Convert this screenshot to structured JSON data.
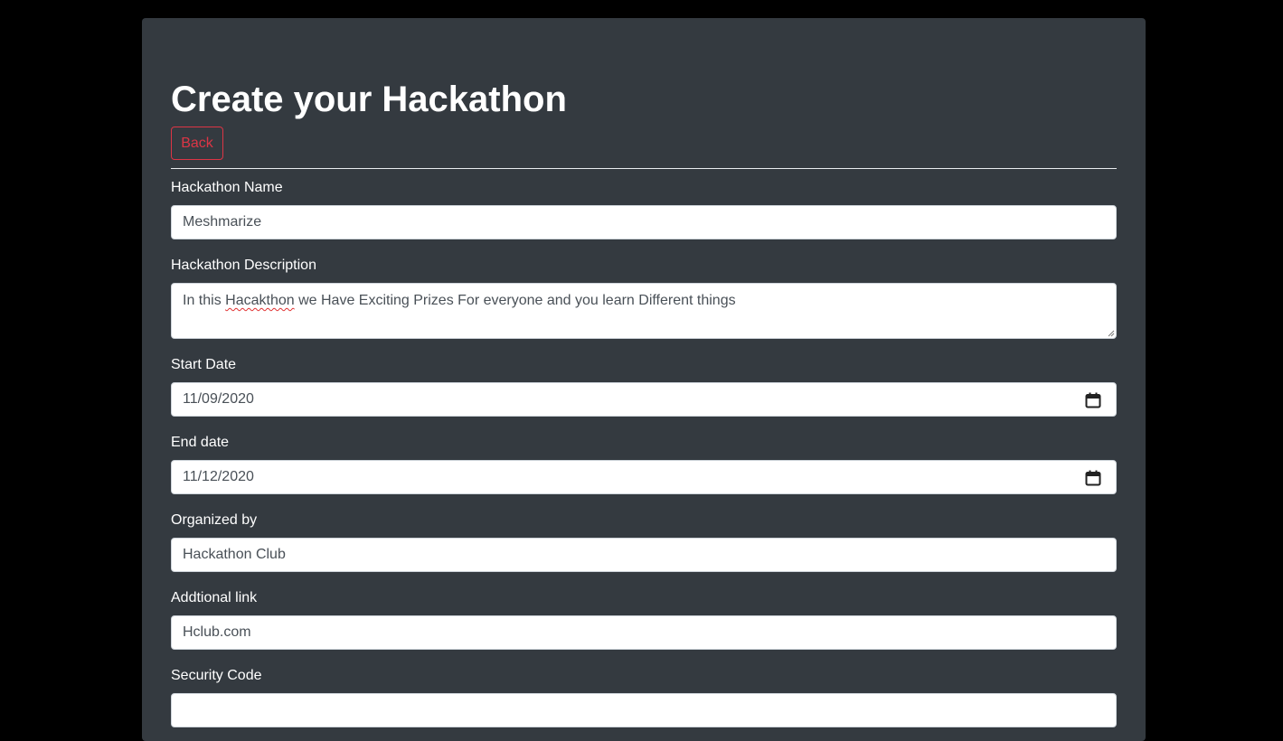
{
  "page": {
    "title": "Create your Hackathon",
    "back_label": "Back"
  },
  "form": {
    "name": {
      "label": "Hackathon Name",
      "value": "Meshmarize"
    },
    "description": {
      "label": "Hackathon Description",
      "value_before": "In this ",
      "value_misspelled": "Hacakthon",
      "value_after": " we Have Exciting Prizes For everyone and you learn Different things"
    },
    "start_date": {
      "label": "Start Date",
      "value": "11/09/2020",
      "icon": "calendar-icon"
    },
    "end_date": {
      "label": "End date",
      "value": "11/12/2020",
      "icon": "calendar-icon"
    },
    "organized_by": {
      "label": "Organized by",
      "value": "Hackathon Club"
    },
    "additional_link": {
      "label": "Addtional link",
      "value": "Hclub.com"
    },
    "security_code": {
      "label": "Security Code",
      "value": ""
    }
  },
  "colors": {
    "page_background": "#000000",
    "panel_background": "#343a40",
    "danger": "#dc3545",
    "input_background": "#ffffff",
    "input_text": "#495057"
  }
}
